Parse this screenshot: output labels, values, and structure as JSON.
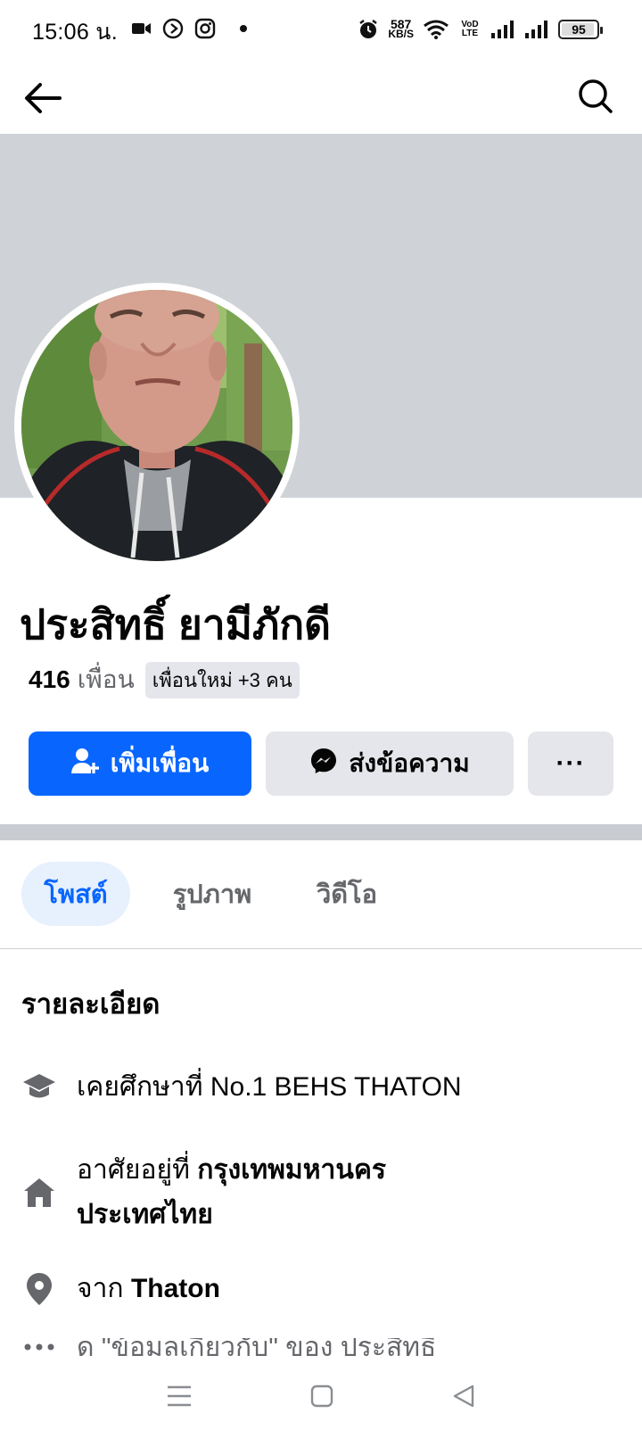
{
  "status_bar": {
    "time": "15:06 น.",
    "speed_value": "587",
    "speed_unit": "KB/S",
    "volte": "VoD LTE",
    "battery": "95",
    "battery_level": 0.95
  },
  "profile": {
    "name": "ประสิทธิ์ ยามีภักดี",
    "friends_count": "416",
    "friends_word": "เพื่อน",
    "new_friends": "เพื่อนใหม่ +3 คน"
  },
  "actions": {
    "add_friend": "เพิ่มเพื่อน",
    "message": "ส่งข้อความ",
    "more": "···"
  },
  "tabs": [
    {
      "label": "โพสต์",
      "active": true
    },
    {
      "label": "รูปภาพ",
      "active": false
    },
    {
      "label": "วิดีโอ",
      "active": false
    }
  ],
  "details": {
    "title": "รายละเอียด",
    "education": "เคยศึกษาที่ No.1 BEHS THATON",
    "live_prefix": "อาศัยอยู่ที่ ",
    "live_place": "กรุงเทพมหานคร ประเทศไทย",
    "from_prefix": "จาก ",
    "from_place": "Thaton",
    "more_text": "ดู \"ข้อมูลเกี่ยวกับ\" ของ ประสิทธิ์"
  },
  "colors": {
    "accent": "#0866ff",
    "cover": "#cfd3d8",
    "button_secondary": "#e4e6eb"
  }
}
